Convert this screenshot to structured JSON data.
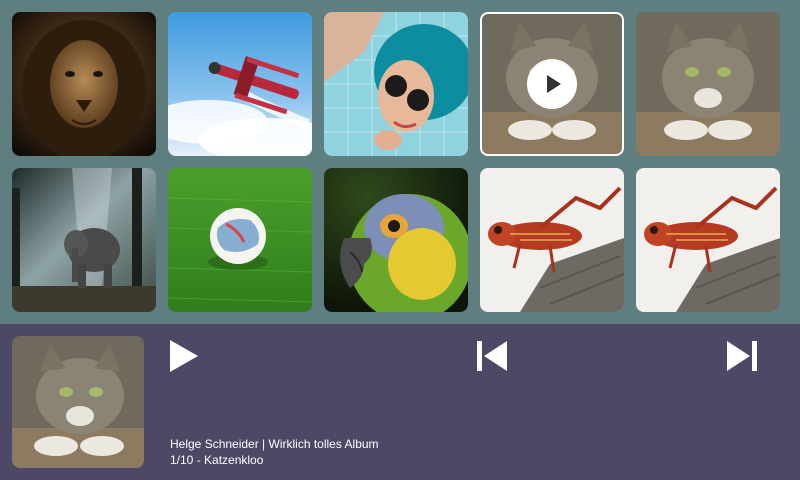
{
  "grid": {
    "tiles": [
      {
        "subject": "lion",
        "icon": "lion-image"
      },
      {
        "subject": "biplane",
        "icon": "biplane-image"
      },
      {
        "subject": "woman-blue-hair",
        "icon": "woman-image"
      },
      {
        "subject": "cat",
        "icon": "cat-image",
        "selected": true,
        "overlay_icon": "play-circle-icon"
      },
      {
        "subject": "cat",
        "icon": "cat-image"
      },
      {
        "subject": "elephant",
        "icon": "elephant-image"
      },
      {
        "subject": "soccer-ball",
        "icon": "soccer-ball-image"
      },
      {
        "subject": "parrot",
        "icon": "parrot-image"
      },
      {
        "subject": "grasshopper",
        "icon": "grasshopper-image"
      },
      {
        "subject": "grasshopper",
        "icon": "grasshopper-image"
      }
    ]
  },
  "player": {
    "cover_icon": "cat-image",
    "controls": {
      "play_icon": "play-icon",
      "prev_icon": "skip-previous-icon",
      "next_icon": "skip-next-icon"
    },
    "artist_album": "Helge Schneider | Wirklich tolles Album",
    "track_line": "1/10 - Katzenkloo"
  },
  "colors": {
    "background": "#5f7e80",
    "player_bar": "#4d4865",
    "text": "#ffffff",
    "selected_outline": "#ffffff"
  }
}
